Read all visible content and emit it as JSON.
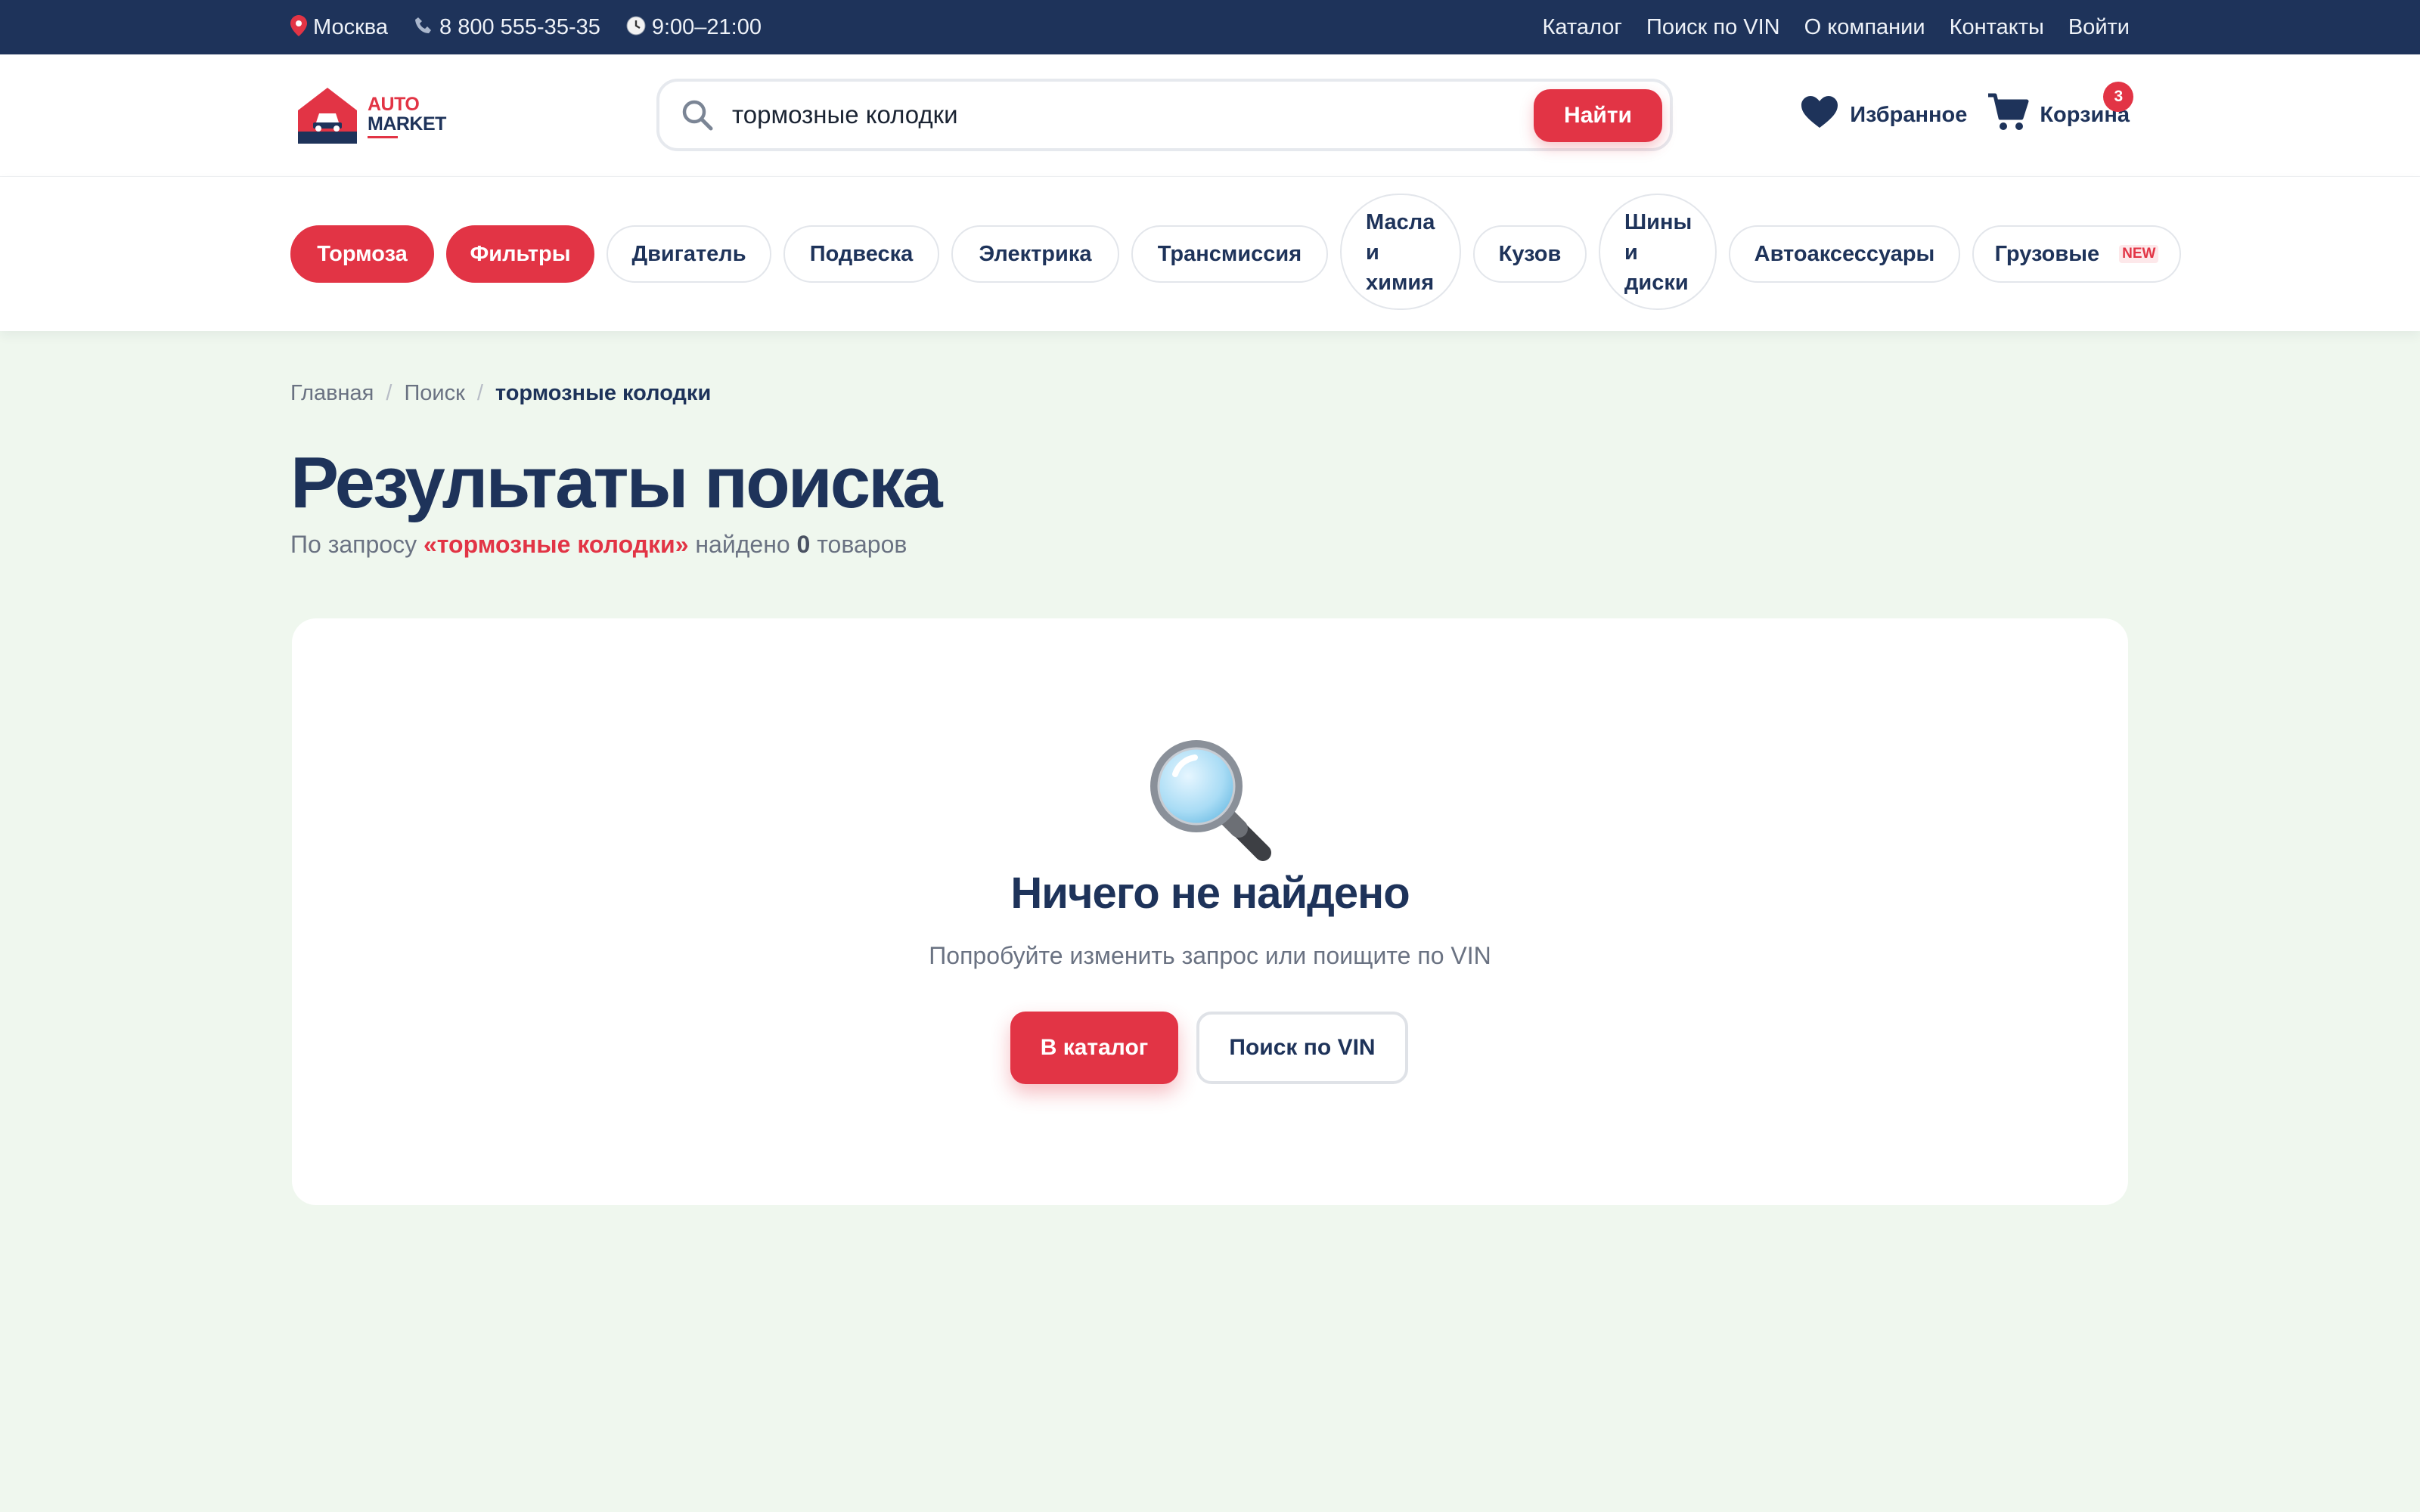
{
  "topbar": {
    "city": "Москва",
    "phone": "8 800 555-35-35",
    "hours": "9:00–21:00",
    "nav": [
      "Каталог",
      "Поиск по VIN",
      "О компании",
      "Контакты",
      "Войти"
    ]
  },
  "header": {
    "logo_line1": "AUTO",
    "logo_line2": "MARKET",
    "search_value": "тормозные колодки",
    "search_button": "Найти",
    "favorites_label": "Избранное",
    "cart_label": "Корзина",
    "cart_count": "3"
  },
  "categories": {
    "brakes": "Тормоза",
    "filters": "Фильтры",
    "engine": "Двигатель",
    "suspension": "Подвеска",
    "electrics": "Электрика",
    "transmission": "Трансмиссия",
    "oils_l1": "Масла",
    "oils_l2": "и",
    "oils_l3": "химия",
    "body": "Кузов",
    "tires_l1": "Шины",
    "tires_l2": "и",
    "tires_l3": "диски",
    "accessories": "Автоаксессуары",
    "trucks": "Грузовые",
    "trucks_tag": "NEW"
  },
  "breadcrumb": {
    "home": "Главная",
    "sep": "/",
    "search": "Поиск",
    "current": "тормозные колодки"
  },
  "main": {
    "title": "Результаты поиска",
    "subtitle_prefix": "По запросу ",
    "subtitle_query": "«тормозные колодки»",
    "subtitle_middle": " найдено ",
    "subtitle_count": "0",
    "subtitle_suffix": " товаров"
  },
  "empty": {
    "icon": "magnifier-icon",
    "title": "Ничего не найдено",
    "subtitle": "Попробуйте изменить запрос или поищите по VIN",
    "catalog_button": "В каталог",
    "vin_button": "Поиск по VIN"
  },
  "colors": {
    "primary": "#1e335a",
    "accent": "#e23445",
    "background": "#eff7ee"
  }
}
